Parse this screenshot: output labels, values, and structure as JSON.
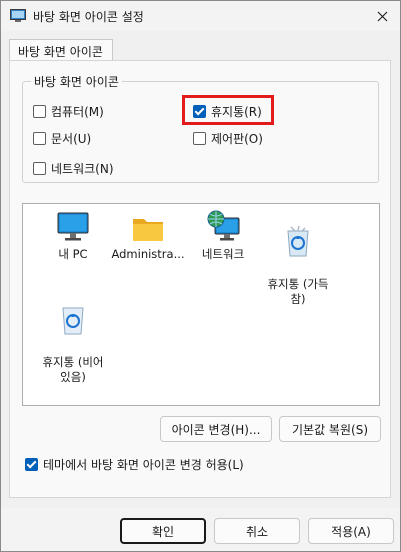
{
  "window": {
    "title": "바탕 화면 아이콘 설정"
  },
  "tabs": [
    {
      "label": "바탕 화면 아이콘"
    }
  ],
  "group": {
    "legend": "바탕 화면 아이콘",
    "checkboxes": [
      {
        "label": "컴퓨터(M)",
        "checked": false
      },
      {
        "label": "휴지통(R)",
        "checked": true
      },
      {
        "label": "문서(U)",
        "checked": false
      },
      {
        "label": "제어판(O)",
        "checked": false
      },
      {
        "label": "네트워크(N)",
        "checked": false
      }
    ]
  },
  "icons": [
    {
      "label": "내 PC",
      "icon": "monitor-icon"
    },
    {
      "label": "Administra...",
      "icon": "folder-icon"
    },
    {
      "label": "네트워크",
      "icon": "network-globe-icon"
    },
    {
      "label": "휴지통 (가득\n참)",
      "icon": "recycle-bin-full-icon"
    },
    {
      "label": "휴지통 (비어\n있음)",
      "icon": "recycle-bin-empty-icon"
    }
  ],
  "buttons": {
    "change_icon": "아이콘 변경(H)...",
    "restore_default": "기본값 복원(S)",
    "ok": "확인",
    "cancel": "취소",
    "apply": "적용(A)"
  },
  "theme_checkbox": {
    "label": "테마에서 바탕 화면 아이콘 변경 허용(L)",
    "checked": true
  },
  "colors": {
    "accent": "#005fb8",
    "highlight": "#e41b1b"
  }
}
